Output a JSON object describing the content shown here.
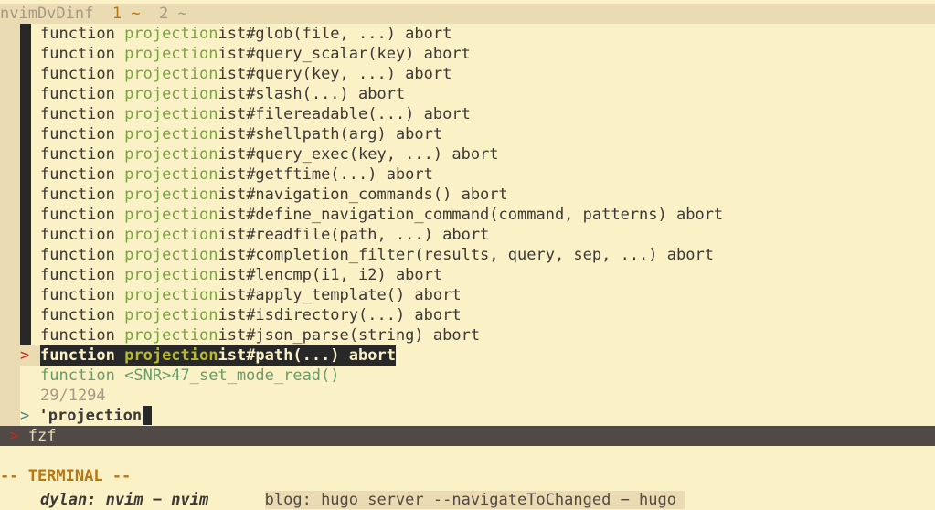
{
  "tabline": {
    "name": "nvimDvDinf",
    "tab1": "1 ~",
    "tab2": "2 ~"
  },
  "results": [
    {
      "kw": "function ",
      "hl": "projection",
      "rest": "ist#glob(file, ...) abort"
    },
    {
      "kw": "function ",
      "hl": "projection",
      "rest": "ist#query_scalar(key) abort"
    },
    {
      "kw": "function ",
      "hl": "projection",
      "rest": "ist#query(key, ...) abort"
    },
    {
      "kw": "function ",
      "hl": "projection",
      "rest": "ist#slash(...) abort"
    },
    {
      "kw": "function ",
      "hl": "projection",
      "rest": "ist#filereadable(...) abort"
    },
    {
      "kw": "function ",
      "hl": "projection",
      "rest": "ist#shellpath(arg) abort"
    },
    {
      "kw": "function ",
      "hl": "projection",
      "rest": "ist#query_exec(key, ...) abort"
    },
    {
      "kw": "function ",
      "hl": "projection",
      "rest": "ist#getftime(...) abort"
    },
    {
      "kw": "function ",
      "hl": "projection",
      "rest": "ist#navigation_commands() abort"
    },
    {
      "kw": "function ",
      "hl": "projection",
      "rest": "ist#define_navigation_command(command, patterns) abort"
    },
    {
      "kw": "function ",
      "hl": "projection",
      "rest": "ist#readfile(path, ...) abort"
    },
    {
      "kw": "function ",
      "hl": "projection",
      "rest": "ist#completion_filter(results, query, sep, ...) abort"
    },
    {
      "kw": "function ",
      "hl": "projection",
      "rest": "ist#lencmp(i1, i2) abort"
    },
    {
      "kw": "function ",
      "hl": "projection",
      "rest": "ist#apply_template() abort"
    },
    {
      "kw": "function ",
      "hl": "projection",
      "rest": "ist#isdirectory(...) abort"
    },
    {
      "kw": "function ",
      "hl": "projection",
      "rest": "ist#json_parse(string) abort"
    }
  ],
  "selected": {
    "marker": ">",
    "kw": "function ",
    "hl": "projection",
    "rest": "ist#path(...) abort"
  },
  "extra_line": "function <SNR>47_set_mode_read()",
  "count": "29/1294",
  "prompt": {
    "marker": ">",
    "query": "'projection"
  },
  "status": {
    "marker": ">",
    "label": "fzf"
  },
  "mode": "-- TERMINAL --",
  "terminal_tabs": {
    "active": "dylan: nvim − nvim",
    "other": "blog: hugo server --navigateToChanged − hugo"
  },
  "colors": {
    "background": "#fbf1c7",
    "match_highlight": "#79a33f",
    "selection_bg": "#282828",
    "status_bg": "#504945",
    "mode_text": "#b57614"
  }
}
